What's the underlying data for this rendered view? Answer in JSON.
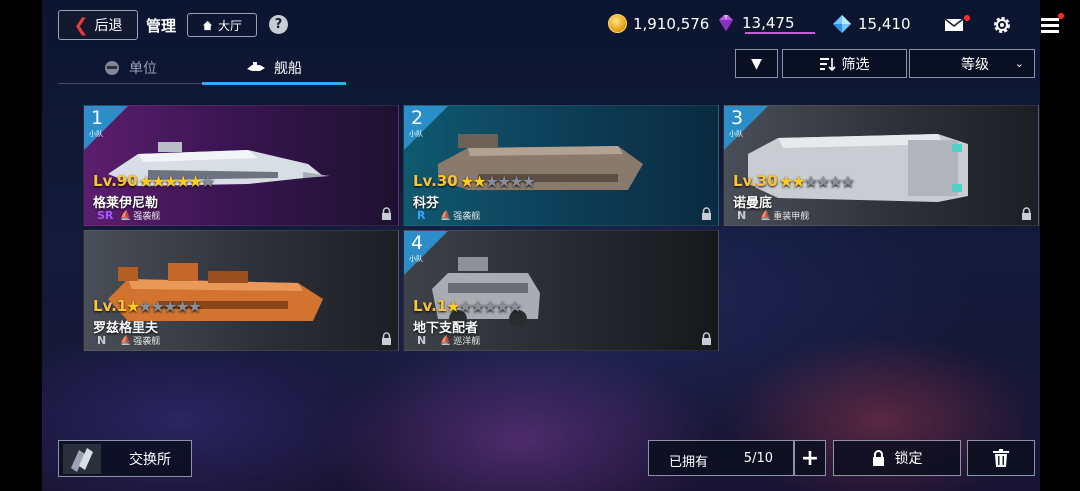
{
  "header": {
    "back_label": "后退",
    "title": "管理",
    "lobby_label": "大厅",
    "help_symbol": "?"
  },
  "currencies": {
    "gold": "1,910,576",
    "crystal": "13,475",
    "diamond": "15,410"
  },
  "tabs": [
    {
      "label": "单位",
      "active": false,
      "icon": "unit-icon"
    },
    {
      "label": "舰船",
      "active": true,
      "icon": "ship-icon"
    }
  ],
  "toolbar": {
    "order_symbol": "▼",
    "filter_label": "筛选",
    "sort_label": "等级"
  },
  "ships": [
    {
      "num": "1",
      "squad": "小队",
      "level": "Lv.90",
      "stars": 5,
      "name": "格莱伊尼勒",
      "rarity": "SR",
      "rarity_color": "#a259ff",
      "type": "强袭舰",
      "bg": "purple"
    },
    {
      "num": "2",
      "squad": "小队",
      "level": "Lv.30",
      "stars": 2,
      "name": "科芬",
      "rarity": "R",
      "rarity_color": "#3aa0ff",
      "type": "强袭舰",
      "bg": "teal"
    },
    {
      "num": "3",
      "squad": "小队",
      "level": "Lv.30",
      "stars": 2,
      "name": "诺曼底",
      "rarity": "N",
      "rarity_color": "#c8ccd4",
      "type": "重装甲舰",
      "bg": "gray"
    },
    {
      "num": "",
      "squad": "",
      "level": "Lv.1",
      "stars": 1,
      "name": "罗兹格里夫",
      "rarity": "N",
      "rarity_color": "#c8ccd4",
      "type": "强袭舰",
      "bg": "gray"
    },
    {
      "num": "4",
      "squad": "小队",
      "level": "Lv.1",
      "stars": 1,
      "name": "地下支配者",
      "rarity": "N",
      "rarity_color": "#c8ccd4",
      "type": "巡洋舰",
      "bg": "gray"
    }
  ],
  "bottom": {
    "exchange_label": "交换所",
    "owned_label": "已拥有",
    "owned_count": "5/10",
    "plus_symbol": "+",
    "lock_label": "锁定"
  },
  "colors": {
    "accent": "#2aa8f0",
    "level": "#f7c43b",
    "star": "#ffcc22",
    "alert": "#ff2e2e"
  }
}
